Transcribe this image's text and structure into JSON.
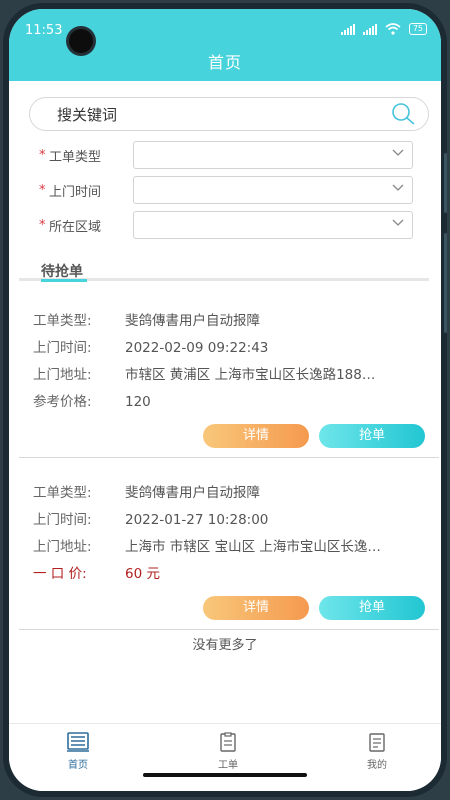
{
  "status_bar": {
    "time": "11:53",
    "battery": "75"
  },
  "header": {
    "title": "首页"
  },
  "search": {
    "placeholder": "搜关键词"
  },
  "filters": [
    {
      "required_mark": "*",
      "label": "工单类型"
    },
    {
      "required_mark": "*",
      "label": "上门时间"
    },
    {
      "required_mark": "*",
      "label": "所在区域"
    }
  ],
  "tab": {
    "label": "待抢单"
  },
  "orders": [
    {
      "fields": [
        {
          "key": "工单类型:",
          "value": "斐鸽傳書用户自动报障"
        },
        {
          "key": "上门时间:",
          "value": "2022-02-09 09:22:43"
        },
        {
          "key": "上门地址:",
          "value": "市辖区 黄浦区 上海市宝山区长逸路188…"
        },
        {
          "key": "参考价格:",
          "value": "120"
        }
      ],
      "detail_label": "详情",
      "grab_label": "抢单"
    },
    {
      "fields": [
        {
          "key": "工单类型:",
          "value": "斐鸽傳書用户自动报障"
        },
        {
          "key": "上门时间:",
          "value": "2022-01-27 10:28:00"
        },
        {
          "key": "上门地址:",
          "value": "上海市 市辖区 宝山区 上海市宝山区长逸…"
        },
        {
          "key": "一 口 价:",
          "value": "60 元"
        }
      ],
      "detail_label": "详情",
      "grab_label": "抢单"
    }
  ],
  "list_end_text": "没有更多了",
  "bottom_nav": [
    {
      "label": "首页",
      "icon": "home-list-icon",
      "active": true
    },
    {
      "label": "工单",
      "icon": "clipboard-icon",
      "active": false
    },
    {
      "label": "我的",
      "icon": "profile-doc-icon",
      "active": false
    }
  ],
  "colors": {
    "accent": "#46d3dc",
    "detail_button": "#f59a4f",
    "grab_button": "#22c6d2",
    "price": "#b22020"
  }
}
